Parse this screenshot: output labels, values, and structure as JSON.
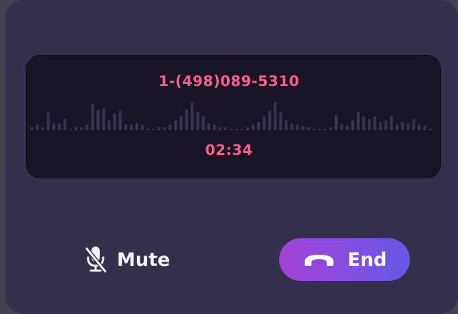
{
  "call": {
    "phone_number": "1-(498)089-5310",
    "duration": "02:34"
  },
  "waveform": {
    "levels": [
      0.1,
      0.2,
      0.1,
      0.65,
      0.25,
      0.25,
      0.4,
      0.05,
      0.1,
      0.1,
      0.2,
      0.95,
      0.75,
      0.8,
      0.35,
      0.6,
      0.7,
      0.2,
      0.2,
      0.25,
      0.2,
      0.05,
      0.05,
      0.1,
      0.1,
      0.2,
      0.35,
      0.5,
      0.75,
      1.0,
      0.65,
      0.5,
      0.25,
      0.2,
      0.1,
      0.1,
      0.05,
      0.05,
      0.05,
      0.1,
      0.2,
      0.3,
      0.5,
      0.7,
      1.0,
      0.65,
      0.35,
      0.25,
      0.2,
      0.15,
      0.1,
      0.05,
      0.05,
      0.05,
      0.1,
      0.55,
      0.2,
      0.15,
      0.35,
      0.65,
      0.5,
      0.4,
      0.5,
      0.3,
      0.35,
      0.5,
      0.2,
      0.3,
      0.25,
      0.4,
      0.2,
      0.15,
      0.05
    ],
    "color": "#3b3350"
  },
  "controls": {
    "mute_label": "Mute",
    "end_label": "End"
  },
  "icons": {
    "mute": "microphone-off-icon",
    "end": "phone-hangup-icon"
  },
  "colors": {
    "accent_text": "#ff5f8a",
    "end_gradient_start": "#a443d6",
    "end_gradient_end": "#6758e6"
  }
}
